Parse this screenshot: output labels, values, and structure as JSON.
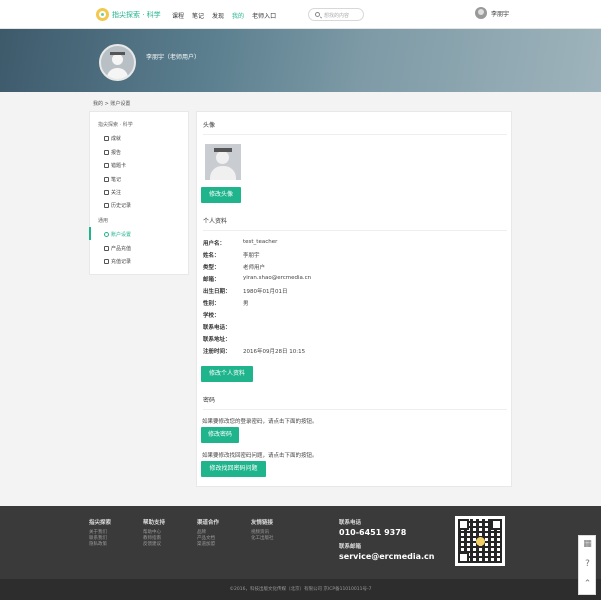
{
  "header": {
    "logo_text": "指尖探索 · 科学",
    "nav": [
      "课程",
      "笔记",
      "发现",
      "我的",
      "老师入口"
    ],
    "active_nav": "我的",
    "search_placeholder": "想找的内容",
    "user_name": "李朋宇"
  },
  "banner": {
    "name": "李朋宇（老师用户）"
  },
  "breadcrumb": "我的 > 账户设置",
  "sidebar": {
    "group1": "指尖探索 · 科学",
    "items1": [
      "成就",
      "报告",
      "错题卡",
      "笔记",
      "关注",
      "历史记录"
    ],
    "group2": "通用",
    "items2": [
      "账户设置",
      "产品充值",
      "充值记录"
    ],
    "active": "账户设置"
  },
  "main": {
    "avatar_title": "头像",
    "change_avatar_btn": "修改头像",
    "profile_title": "个人资料",
    "profile": [
      {
        "k": "用户名：",
        "v": "test_teacher"
      },
      {
        "k": "姓名：",
        "v": "李朋宇"
      },
      {
        "k": "类型：",
        "v": "老师用户"
      },
      {
        "k": "邮箱：",
        "v": "yiran.shao@ercmedia.cn"
      },
      {
        "k": "出生日期：",
        "v": "1980年01月01日"
      },
      {
        "k": "性别：",
        "v": "男"
      },
      {
        "k": "学校：",
        "v": ""
      },
      {
        "k": "联系电话：",
        "v": ""
      },
      {
        "k": "联系地址：",
        "v": ""
      },
      {
        "k": "注册时间：",
        "v": "2016年09月28日 10:15"
      }
    ],
    "edit_profile_btn": "修改个人资料",
    "password_title": "密码",
    "pw_text1": "如果要修改您的登录密码，请点击下面的按钮。",
    "change_pw_btn": "修改密码",
    "pw_text2": "如果要修改找回密码问题，请点击下面的按钮。",
    "change_q_btn": "修改找回密码问题"
  },
  "footer": {
    "cols": [
      {
        "title": "指尖探索",
        "links": [
          "关于我们",
          "联系我们",
          "隐私政策"
        ]
      },
      {
        "title": "帮助支持",
        "links": [
          "帮助中心",
          "教师指南",
          "反馈建议"
        ]
      },
      {
        "title": "渠道合作",
        "links": [
          "品牌",
          "产品文档",
          "渠道加盟"
        ]
      },
      {
        "title": "友情链接",
        "links": [
          "视频资讯",
          "化工出版社"
        ]
      }
    ],
    "phone_label": "联系电话",
    "phone": "010-6451 9378",
    "email_label": "联系邮箱",
    "email": "service@ercmedia.cn",
    "copyright": "©2016，科技出版文化传媒（北京）有限公司  京ICP备11010011号-7"
  },
  "colors": {
    "accent": "#1fb48c",
    "footer": "#3a3a3a"
  }
}
